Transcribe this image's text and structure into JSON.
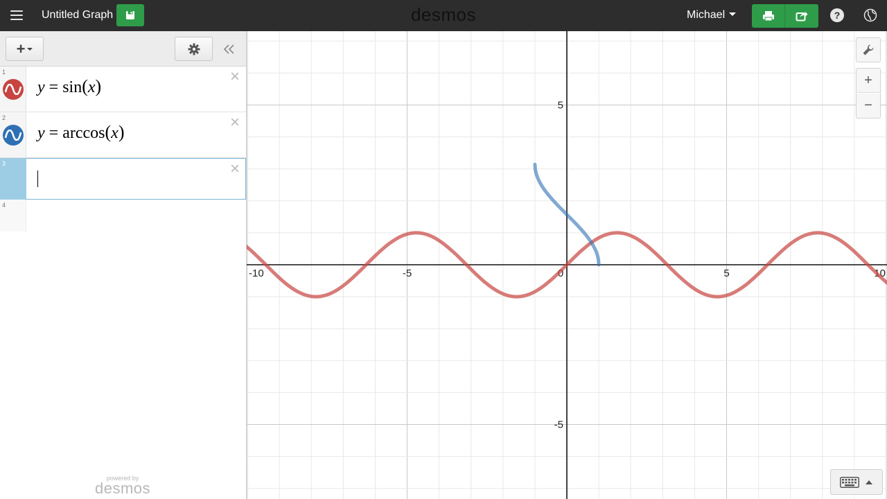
{
  "header": {
    "graph_title": "Untitled Graph",
    "logo": "desmos",
    "user_name": "Michael"
  },
  "sidebar": {
    "expressions": [
      {
        "num": "1",
        "var": "y",
        "eq": "=",
        "func": "sin",
        "arg": "x",
        "color": "#c74440"
      },
      {
        "num": "2",
        "var": "y",
        "eq": "=",
        "func": "arccos",
        "arg": "x",
        "color": "#2d70b3"
      },
      {
        "num": "3"
      },
      {
        "num": "4"
      }
    ],
    "powered_by_small": "powered by",
    "powered_by_brand": "desmos"
  },
  "graph": {
    "x_ticks": [
      "-10",
      "-5",
      "0",
      "5",
      "10"
    ],
    "y_ticks": [
      "5",
      "-5"
    ]
  },
  "chart_data": {
    "type": "line",
    "title": "",
    "xlabel": "",
    "ylabel": "",
    "xlim": [
      -10,
      10
    ],
    "grid": true,
    "series": [
      {
        "name": "y=sin(x)",
        "color": "#c74440",
        "expression": "y=sin(x)"
      },
      {
        "name": "y=arccos(x)",
        "color": "#2d70b3",
        "expression": "y=arccos(x)"
      }
    ]
  }
}
